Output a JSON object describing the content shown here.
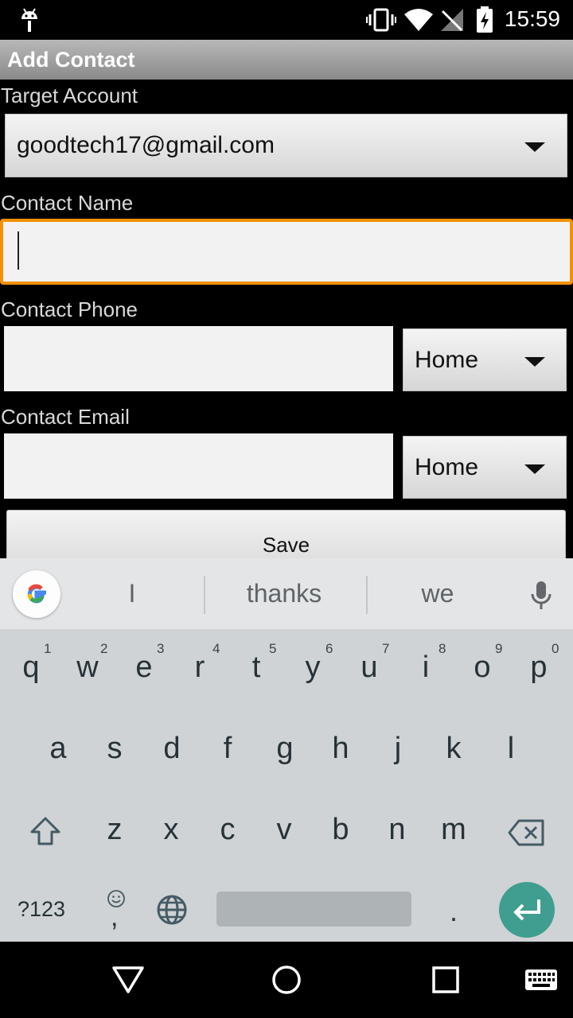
{
  "status_bar": {
    "time": "15:59"
  },
  "app": {
    "title": "Add Contact"
  },
  "form": {
    "target_account_label": "Target Account",
    "target_account_value": "goodtech17@gmail.com",
    "contact_name_label": "Contact Name",
    "contact_name_value": "",
    "contact_phone_label": "Contact Phone",
    "phone_type": "Home",
    "contact_email_label": "Contact Email",
    "email_type": "Home",
    "save_label": "Save"
  },
  "keyboard": {
    "suggestions": [
      "I",
      "thanks",
      "we"
    ],
    "row1": [
      "q",
      "w",
      "e",
      "r",
      "t",
      "y",
      "u",
      "i",
      "o",
      "p"
    ],
    "row1_numbers": [
      "1",
      "2",
      "3",
      "4",
      "5",
      "6",
      "7",
      "8",
      "9",
      "0"
    ],
    "row2": [
      "a",
      "s",
      "d",
      "f",
      "g",
      "h",
      "j",
      "k",
      "l"
    ],
    "row3": [
      "z",
      "x",
      "c",
      "v",
      "b",
      "n",
      "m"
    ],
    "symbols_label": "?123",
    "comma": ",",
    "period": "."
  }
}
